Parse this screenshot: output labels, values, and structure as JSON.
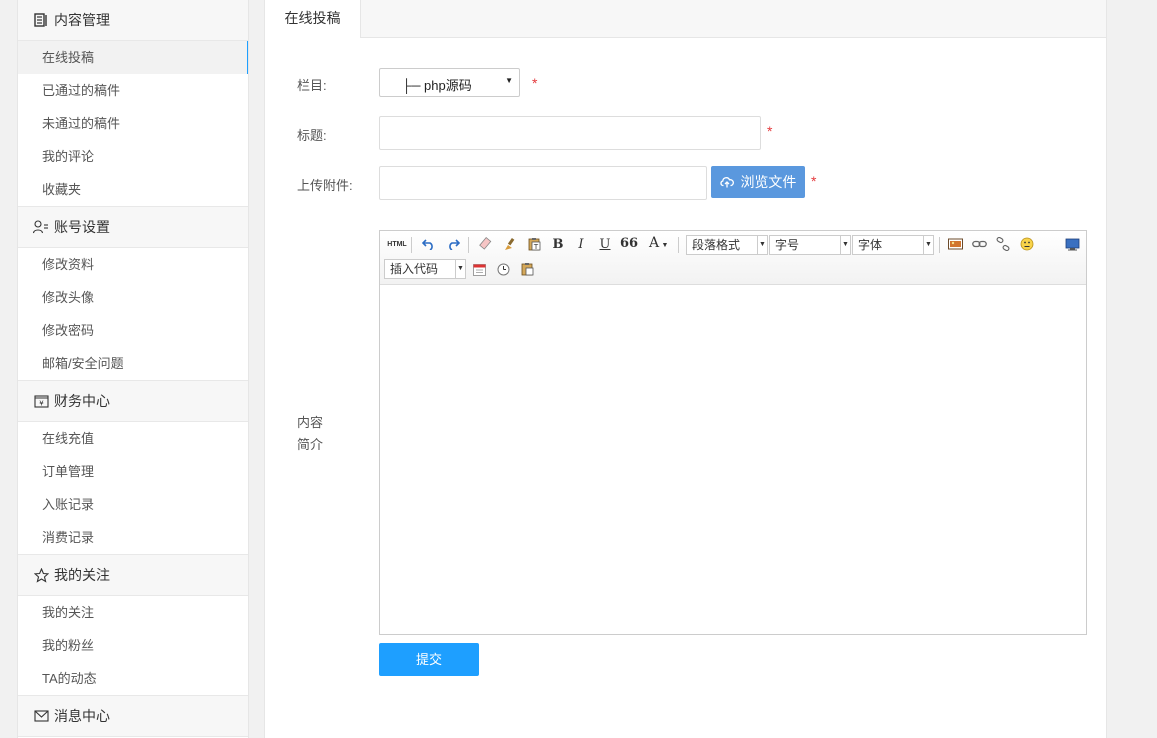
{
  "sidebar": {
    "sections": [
      {
        "title": "内容管理",
        "icon": "document-icon",
        "items": [
          "在线投稿",
          "已通过的稿件",
          "未通过的稿件",
          "我的评论",
          "收藏夹"
        ]
      },
      {
        "title": "账号设置",
        "icon": "user-icon",
        "items": [
          "修改资料",
          "修改头像",
          "修改密码",
          "邮箱/安全问题"
        ]
      },
      {
        "title": "财务中心",
        "icon": "wallet-icon",
        "items": [
          "在线充值",
          "订单管理",
          "入账记录",
          "消费记录"
        ]
      },
      {
        "title": "我的关注",
        "icon": "star-icon",
        "items": [
          "我的关注",
          "我的粉丝",
          "TA的动态"
        ]
      },
      {
        "title": "消息中心",
        "icon": "mail-icon",
        "items": []
      }
    ]
  },
  "main": {
    "tab_label": "在线投稿",
    "form": {
      "column_label": "栏目:",
      "column_value": "├─ php源码",
      "title_label": "标题:",
      "title_value": "",
      "attach_label": "上传附件:",
      "attach_value": "",
      "browse_label": "浏览文件",
      "content_label_1": "内容",
      "content_label_2": "简介",
      "required_mark": "*",
      "submit_label": "提交"
    },
    "editor": {
      "html_label": "HTML",
      "bold_label": "B",
      "italic_label": "I",
      "underline_label": "U",
      "quote_label": "66",
      "fontcolor_label": "A",
      "paragraph_label": "段落格式",
      "fontsize_label": "字号",
      "fontfamily_label": "字体",
      "insertcode_label": "插入代码"
    }
  },
  "colors": {
    "accent": "#1e9fff",
    "browse_button": "#5a98de",
    "required": "#e4393c"
  }
}
